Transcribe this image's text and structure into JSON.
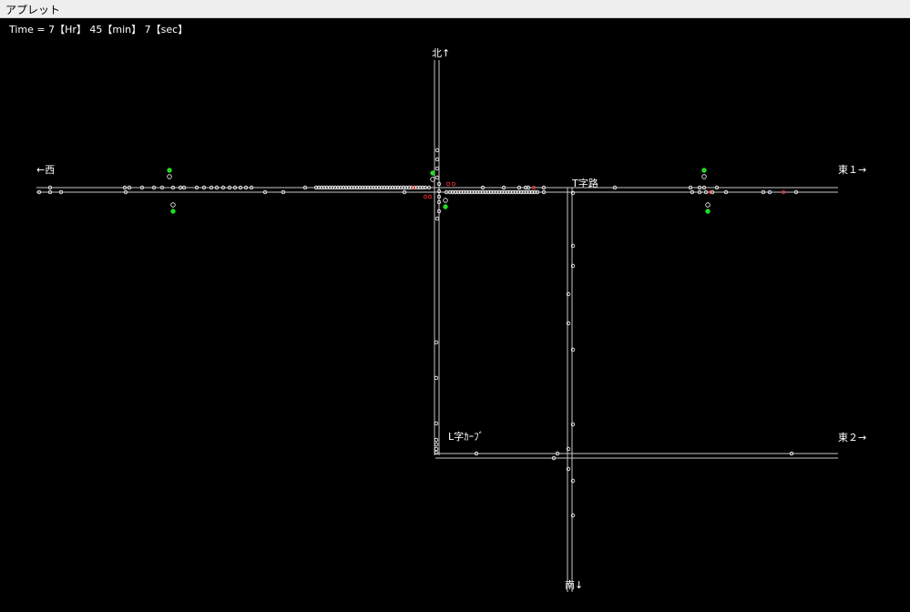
{
  "window": {
    "title": "アプレット"
  },
  "status": {
    "time_text": "Time = 7【Hr】 45【min】 7【sec】"
  },
  "labels": {
    "north": "北↑",
    "west": "←西",
    "east1": "東１→",
    "east2": "東２→",
    "south": "南↓",
    "t_junction": "T字路",
    "l_curve": "L字ｶｰﾌﾞ"
  },
  "colors": {
    "road": "#c8c8c8",
    "vehicle": "#ffffff",
    "vehicle_stopped": "#ff3030",
    "signal_green": "#22dd22",
    "signal_off": "#ffffff"
  }
}
